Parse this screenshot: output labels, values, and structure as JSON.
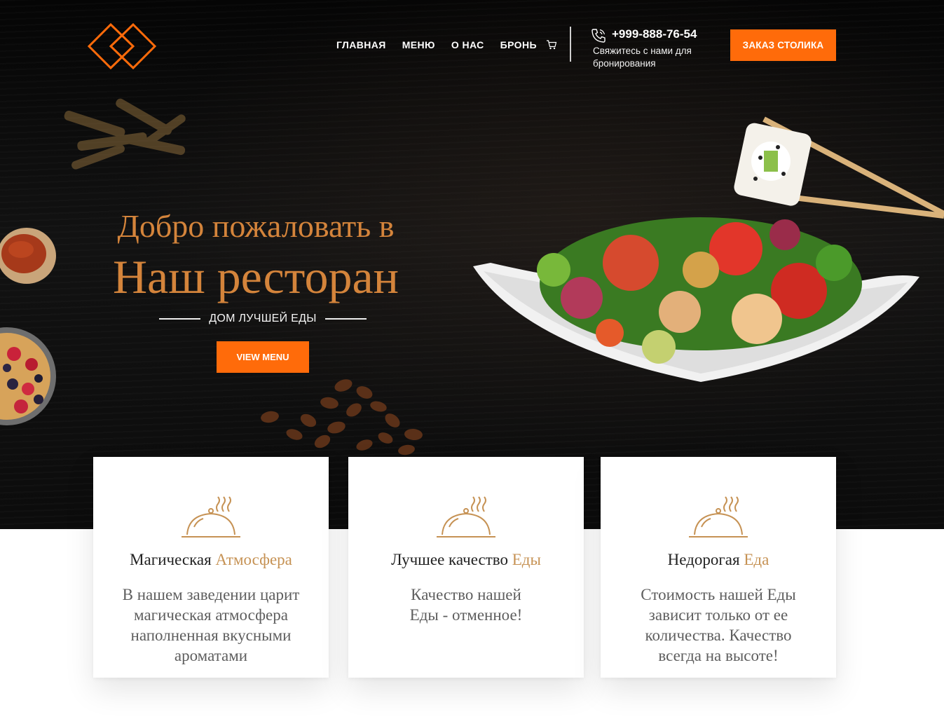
{
  "brand": {
    "accent_color": "#ff6b0a",
    "gold_color": "#d4843b",
    "logo_icon": "interlocked-diamonds-logo"
  },
  "nav": {
    "items": [
      {
        "label": "ГЛАВНАЯ"
      },
      {
        "label": "МЕНЮ"
      },
      {
        "label": "О НАС"
      },
      {
        "label": "БРОНЬ"
      }
    ],
    "cart_icon": "cart-icon"
  },
  "contact": {
    "phone_icon": "phone-icon",
    "phone": "+999-888-76-54",
    "caption": "Свяжитесь с нами для бронирования"
  },
  "header": {
    "reserve_label": "ЗАКАЗ СТОЛИКА"
  },
  "hero": {
    "welcome": "Добро пожаловать в",
    "title": "Наш ресторан",
    "tagline": "ДОМ ЛУЧШЕЙ ЕДЫ",
    "button_label": "VIEW MENU"
  },
  "features": [
    {
      "icon": "cloche-icon",
      "title_main": "Магическая ",
      "title_accent": "Атмосфера",
      "text_lines": [
        "В нашем заведении царит",
        "магическая атмосфера",
        "наполненная вкусными",
        "ароматами"
      ]
    },
    {
      "icon": "cloche-icon",
      "title_main": "Лучшее качество ",
      "title_accent": "Еды",
      "text_lines": [
        "Качество нашей",
        "Еды - отменное!"
      ]
    },
    {
      "icon": "cloche-icon",
      "title_main": "Недорогая ",
      "title_accent": "Еда",
      "text_lines": [
        "Стоимость нашей Еды",
        "зависит только от ее",
        "количества. Качество",
        "всегда на высоте!"
      ]
    }
  ]
}
